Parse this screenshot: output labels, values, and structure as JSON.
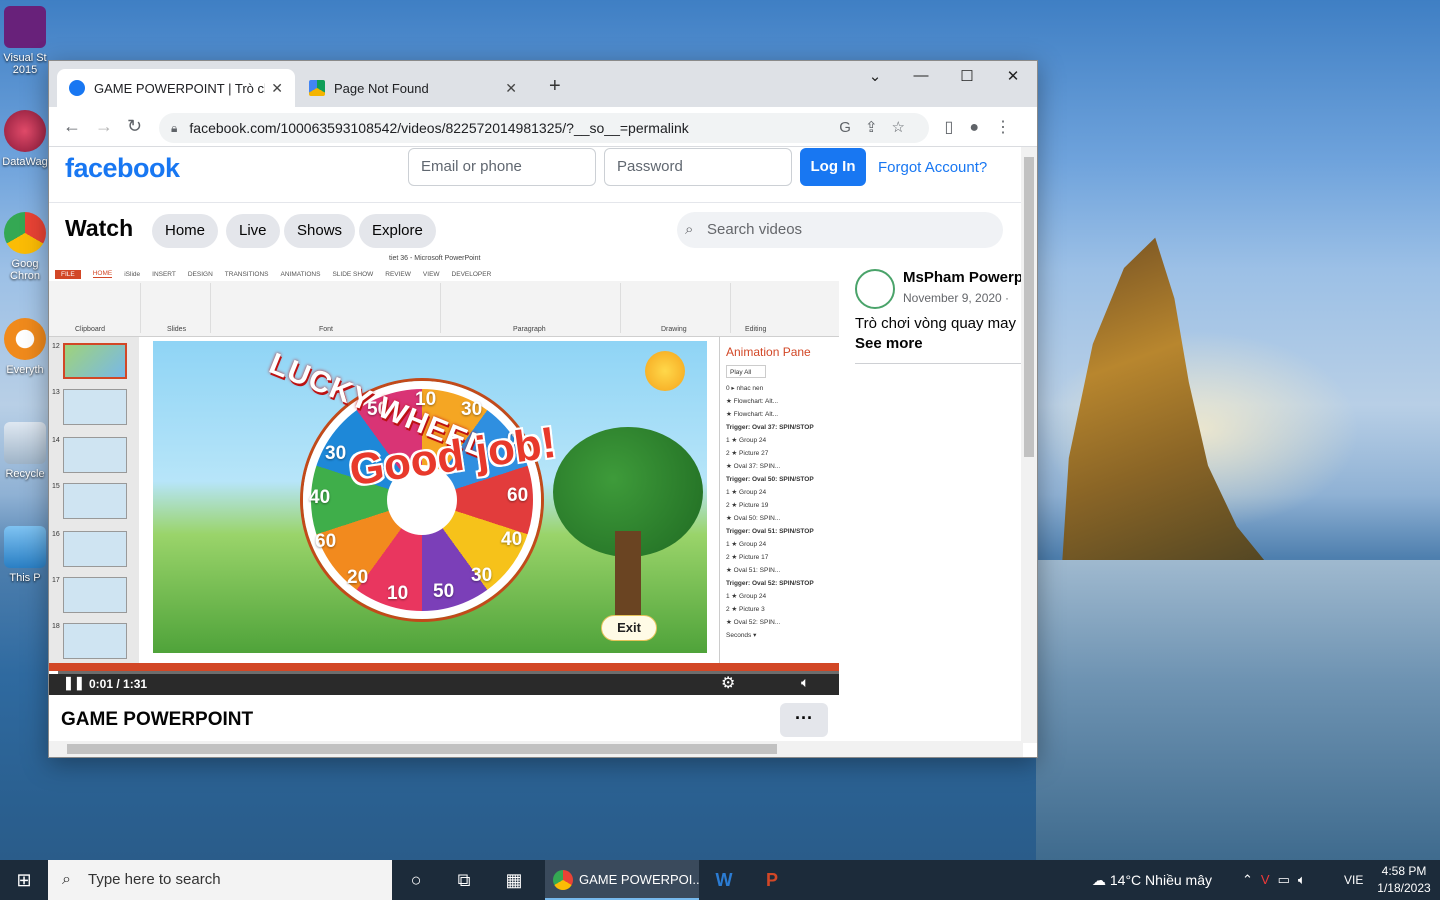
{
  "desktop": {
    "icons": [
      {
        "label": "Visual St\n2015",
        "icon": "visual-studio-icon"
      },
      {
        "label": "DataWag",
        "icon": "datawag-icon"
      },
      {
        "label": "Goog\nChron",
        "icon": "chrome-icon"
      },
      {
        "label": "Everyth",
        "icon": "everything-icon"
      },
      {
        "label": "Recycle",
        "icon": "recycle-bin-icon"
      },
      {
        "label": "This P",
        "icon": "this-pc-icon"
      }
    ]
  },
  "browser": {
    "tabs": [
      {
        "title": "GAME POWERPOINT | Trò chơi v",
        "icon": "facebook-icon",
        "active": true
      },
      {
        "title": "Page Not Found",
        "icon": "google-drive-icon",
        "active": false
      }
    ],
    "new_tab": "+",
    "url": "facebook.com/100063593108542/videos/822572014981325/?__so__=permalink"
  },
  "facebook": {
    "logo": "facebook",
    "email_placeholder": "Email or phone",
    "password_placeholder": "Password",
    "login_label": "Log In",
    "forgot_label": "Forgot Account?",
    "watch_title": "Watch",
    "nav": [
      "Home",
      "Live",
      "Shows",
      "Explore"
    ],
    "search_placeholder": "Search videos",
    "video": {
      "title": "GAME POWERPOINT",
      "time": "0:01 / 1:31",
      "progress": 0.011,
      "more": "···"
    },
    "channel": {
      "name": "MsPham Powerpc",
      "date": "November 9, 2020 · ",
      "description": "Trò chơi vòng quay may r",
      "see_more": "See more"
    }
  },
  "ppt": {
    "window_title": "tiet 36 - Microsoft PowerPoint",
    "tabs": [
      "FILE",
      "HOME",
      "iSlide",
      "INSERT",
      "DESIGN",
      "TRANSITIONS",
      "ANIMATIONS",
      "SLIDE SHOW",
      "REVIEW",
      "VIEW",
      "DEVELOPER"
    ],
    "groups": [
      "Clipboard",
      "Slides",
      "Font",
      "Paragraph",
      "Drawing",
      "Editing"
    ],
    "slide_numbers": [
      "12",
      "13",
      "14",
      "15",
      "16",
      "17",
      "18"
    ],
    "slide": {
      "heading": "LUCKY WHEEL",
      "center_text": "Good job!",
      "numbers": [
        "50",
        "10",
        "30",
        "0",
        "60",
        "40",
        "30",
        "50",
        "10",
        "20",
        "60",
        "40",
        "30"
      ],
      "exit": "Exit"
    },
    "animation_pane": {
      "title": "Animation Pane",
      "play_all": "Play All",
      "rows": [
        "0 ▸ nhac nen",
        "★ Flowchart: Alt...",
        "★ Flowchart: Alt...",
        "Trigger: Oval 37: SPIN/STOP",
        "1 ★ Group 24",
        "2 ★ Picture 27",
        "★ Oval 37: SPIN...",
        "Trigger: Oval 50: SPIN/STOP",
        "1 ★ Group 24",
        "2 ★ Picture 19",
        "★ Oval 50: SPIN...",
        "Trigger: Oval 51: SPIN/STOP",
        "1 ★ Group 24",
        "2 ★ Picture 17",
        "★ Oval 51: SPIN...",
        "Trigger: Oval 52: SPIN/STOP",
        "1 ★ Group 24",
        "2 ★ Picture 3",
        "★ Oval 52: SPIN...",
        "Seconds ▾"
      ]
    }
  },
  "taskbar": {
    "search_placeholder": "Type here to search",
    "active_app": "GAME POWERPOI...",
    "weather": "14°C  Nhiều mây",
    "language": "VIE",
    "time": "4:58 PM",
    "date": "1/18/2023"
  }
}
